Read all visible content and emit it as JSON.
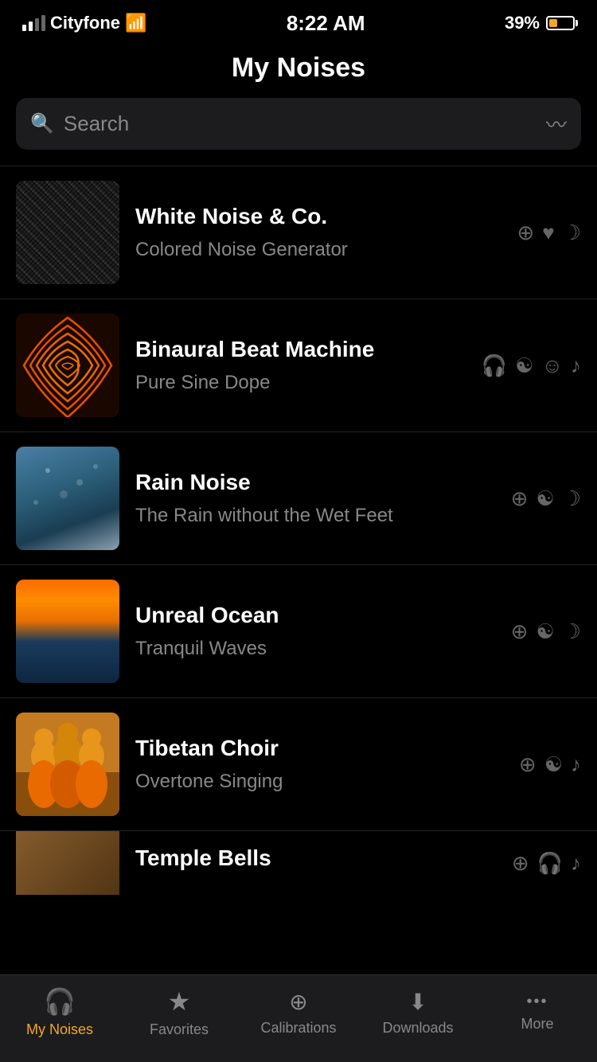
{
  "status_bar": {
    "carrier": "Cityfone",
    "time": "8:22 AM",
    "battery": "39%"
  },
  "header": {
    "title": "My Noises"
  },
  "search": {
    "placeholder": "Search"
  },
  "noise_items": [
    {
      "id": "white-noise",
      "name": "White Noise & Co.",
      "subtitle": "Colored Noise Generator",
      "thumb_class": "thumb-white-noise",
      "icons": [
        "⊕",
        "♥",
        "☽"
      ]
    },
    {
      "id": "binaural",
      "name": "Binaural Beat Machine",
      "subtitle": "Pure Sine Dope",
      "thumb_class": "thumb-binaural",
      "icons": [
        "🎧",
        "☯",
        "☺",
        "♪"
      ]
    },
    {
      "id": "rain",
      "name": "Rain Noise",
      "subtitle": "The Rain without the Wet Feet",
      "thumb_class": "thumb-rain",
      "icons": [
        "⊕",
        "☯",
        "☽"
      ]
    },
    {
      "id": "ocean",
      "name": "Unreal Ocean",
      "subtitle": "Tranquil Waves",
      "thumb_class": "thumb-ocean",
      "icons": [
        "⊕",
        "☯",
        "☽"
      ]
    },
    {
      "id": "tibetan",
      "name": "Tibetan Choir",
      "subtitle": "Overtone Singing",
      "thumb_class": "thumb-tibetan",
      "icons": [
        "⊕",
        "☯",
        "♪"
      ]
    }
  ],
  "partial_item": {
    "name": "Temple Bells",
    "thumb_class": "thumb-temple",
    "icons": [
      "⊕",
      "🎧",
      "♪"
    ]
  },
  "tabs": [
    {
      "id": "my-noises",
      "label": "My Noises",
      "icon": "🎧",
      "active": true
    },
    {
      "id": "favorites",
      "label": "Favorites",
      "icon": "★",
      "active": false
    },
    {
      "id": "calibrations",
      "label": "Calibrations",
      "icon": "⊕",
      "active": false
    },
    {
      "id": "downloads",
      "label": "Downloads",
      "icon": "⬇",
      "active": false
    },
    {
      "id": "more",
      "label": "More",
      "icon": "•••",
      "active": false
    }
  ]
}
